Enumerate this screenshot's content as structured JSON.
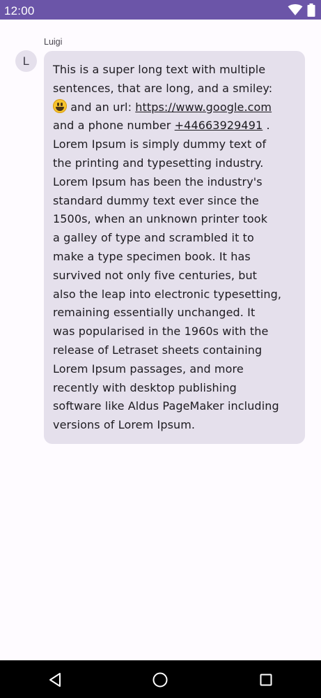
{
  "status_bar": {
    "time": "12:00",
    "icons": [
      "wifi-icon",
      "battery-icon"
    ],
    "background": "#6b55a8"
  },
  "chat": {
    "message": {
      "sender_name": "Luigi",
      "avatar_initial": "L",
      "bubble_color": "#e5e0ec",
      "emoji": "grinning-face-emoji",
      "link_url": "https://www.google.com",
      "phone_number": "+44663929491",
      "lines": [
        "This is a super long text with multiple",
        "sentences, that are long, and a smiley:",
        "and an url:",
        "and a phone number",
        ".",
        "Lorem Ipsum is simply dummy text of",
        "the printing and typesetting industry.",
        "Lorem Ipsum has been the industry's",
        "standard dummy text ever since the",
        "1500s, when an unknown printer took",
        "a galley of type and scrambled it to",
        "make a type specimen book. It has",
        "survived not only five centuries, but",
        "also the leap into electronic typesetting,",
        "remaining essentially unchanged. It",
        "was popularised in the 1960s with the",
        "release of Letraset sheets containing",
        "Lorem Ipsum passages, and more",
        "recently with desktop publishing",
        "software like Aldus PageMaker including",
        "versions of Lorem Ipsum."
      ]
    }
  },
  "nav_bar": {
    "buttons": [
      "back-icon",
      "home-icon",
      "recents-icon"
    ]
  }
}
